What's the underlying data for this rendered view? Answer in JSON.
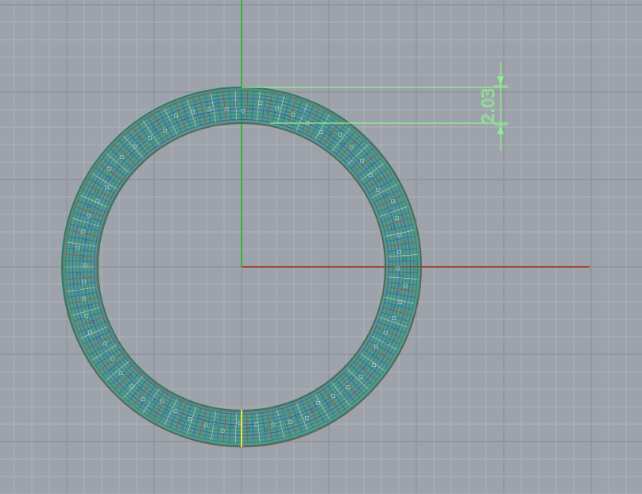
{
  "viewport": {
    "name": "Top",
    "background_color": "#9ea3ab",
    "grid_minor_color": "#aeb2b9",
    "grid_major_color": "#8b9098",
    "x_axis_color": "#a0463a",
    "y_axis_color": "#3fae3f"
  },
  "ring_object": {
    "wire_color_primary": "#1f8a73",
    "wire_color_secondary": "#2a5fa8",
    "wire_color_accent": "#c0392b",
    "seam_color": "#f2e23a"
  },
  "dimension": {
    "value_text": "2.03",
    "color": "#8ef08e"
  }
}
